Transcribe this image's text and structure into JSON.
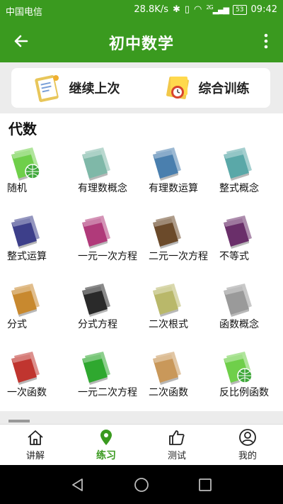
{
  "status": {
    "carrier": "中国电信",
    "speed": "28.8K/s",
    "network": "2G",
    "battery": "53",
    "time": "09:42"
  },
  "appbar": {
    "title": "初中数学"
  },
  "quick": [
    {
      "label": "继续上次",
      "icon": "clipboard-icon"
    },
    {
      "label": "综合训练",
      "icon": "training-icon"
    }
  ],
  "section": {
    "title": "代数"
  },
  "topics": [
    {
      "label": "随机",
      "color": "#6fcf4a",
      "globe": true
    },
    {
      "label": "有理数概念",
      "color": "#7fb8a8"
    },
    {
      "label": "有理数运算",
      "color": "#4a7fae"
    },
    {
      "label": "整式概念",
      "color": "#5aa8a8"
    },
    {
      "label": "整式运算",
      "color": "#3d3f8a"
    },
    {
      "label": "一元一次方程",
      "color": "#b03a7a"
    },
    {
      "label": "二元一次方程",
      "color": "#6b4a2a"
    },
    {
      "label": "不等式",
      "color": "#6a2f6a"
    },
    {
      "label": "分式",
      "color": "#c8892f"
    },
    {
      "label": "分式方程",
      "color": "#2a2a2a"
    },
    {
      "label": "二次根式",
      "color": "#b9b86a"
    },
    {
      "label": "函数概念",
      "color": "#9a9a9a"
    },
    {
      "label": "一次函数",
      "color": "#c0352f"
    },
    {
      "label": "一元二次方程",
      "color": "#2fa82f"
    },
    {
      "label": "二次函数",
      "color": "#c9985a"
    },
    {
      "label": "反比例函数",
      "color": "#6fcf4a",
      "globe": true
    }
  ],
  "tabs": [
    {
      "label": "讲解",
      "icon": "home-icon"
    },
    {
      "label": "练习",
      "icon": "location-pin-icon",
      "active": true
    },
    {
      "label": "测试",
      "icon": "thumbs-up-icon"
    },
    {
      "label": "我的",
      "icon": "user-icon"
    }
  ],
  "colors": {
    "primary": "#3a9a1f"
  }
}
